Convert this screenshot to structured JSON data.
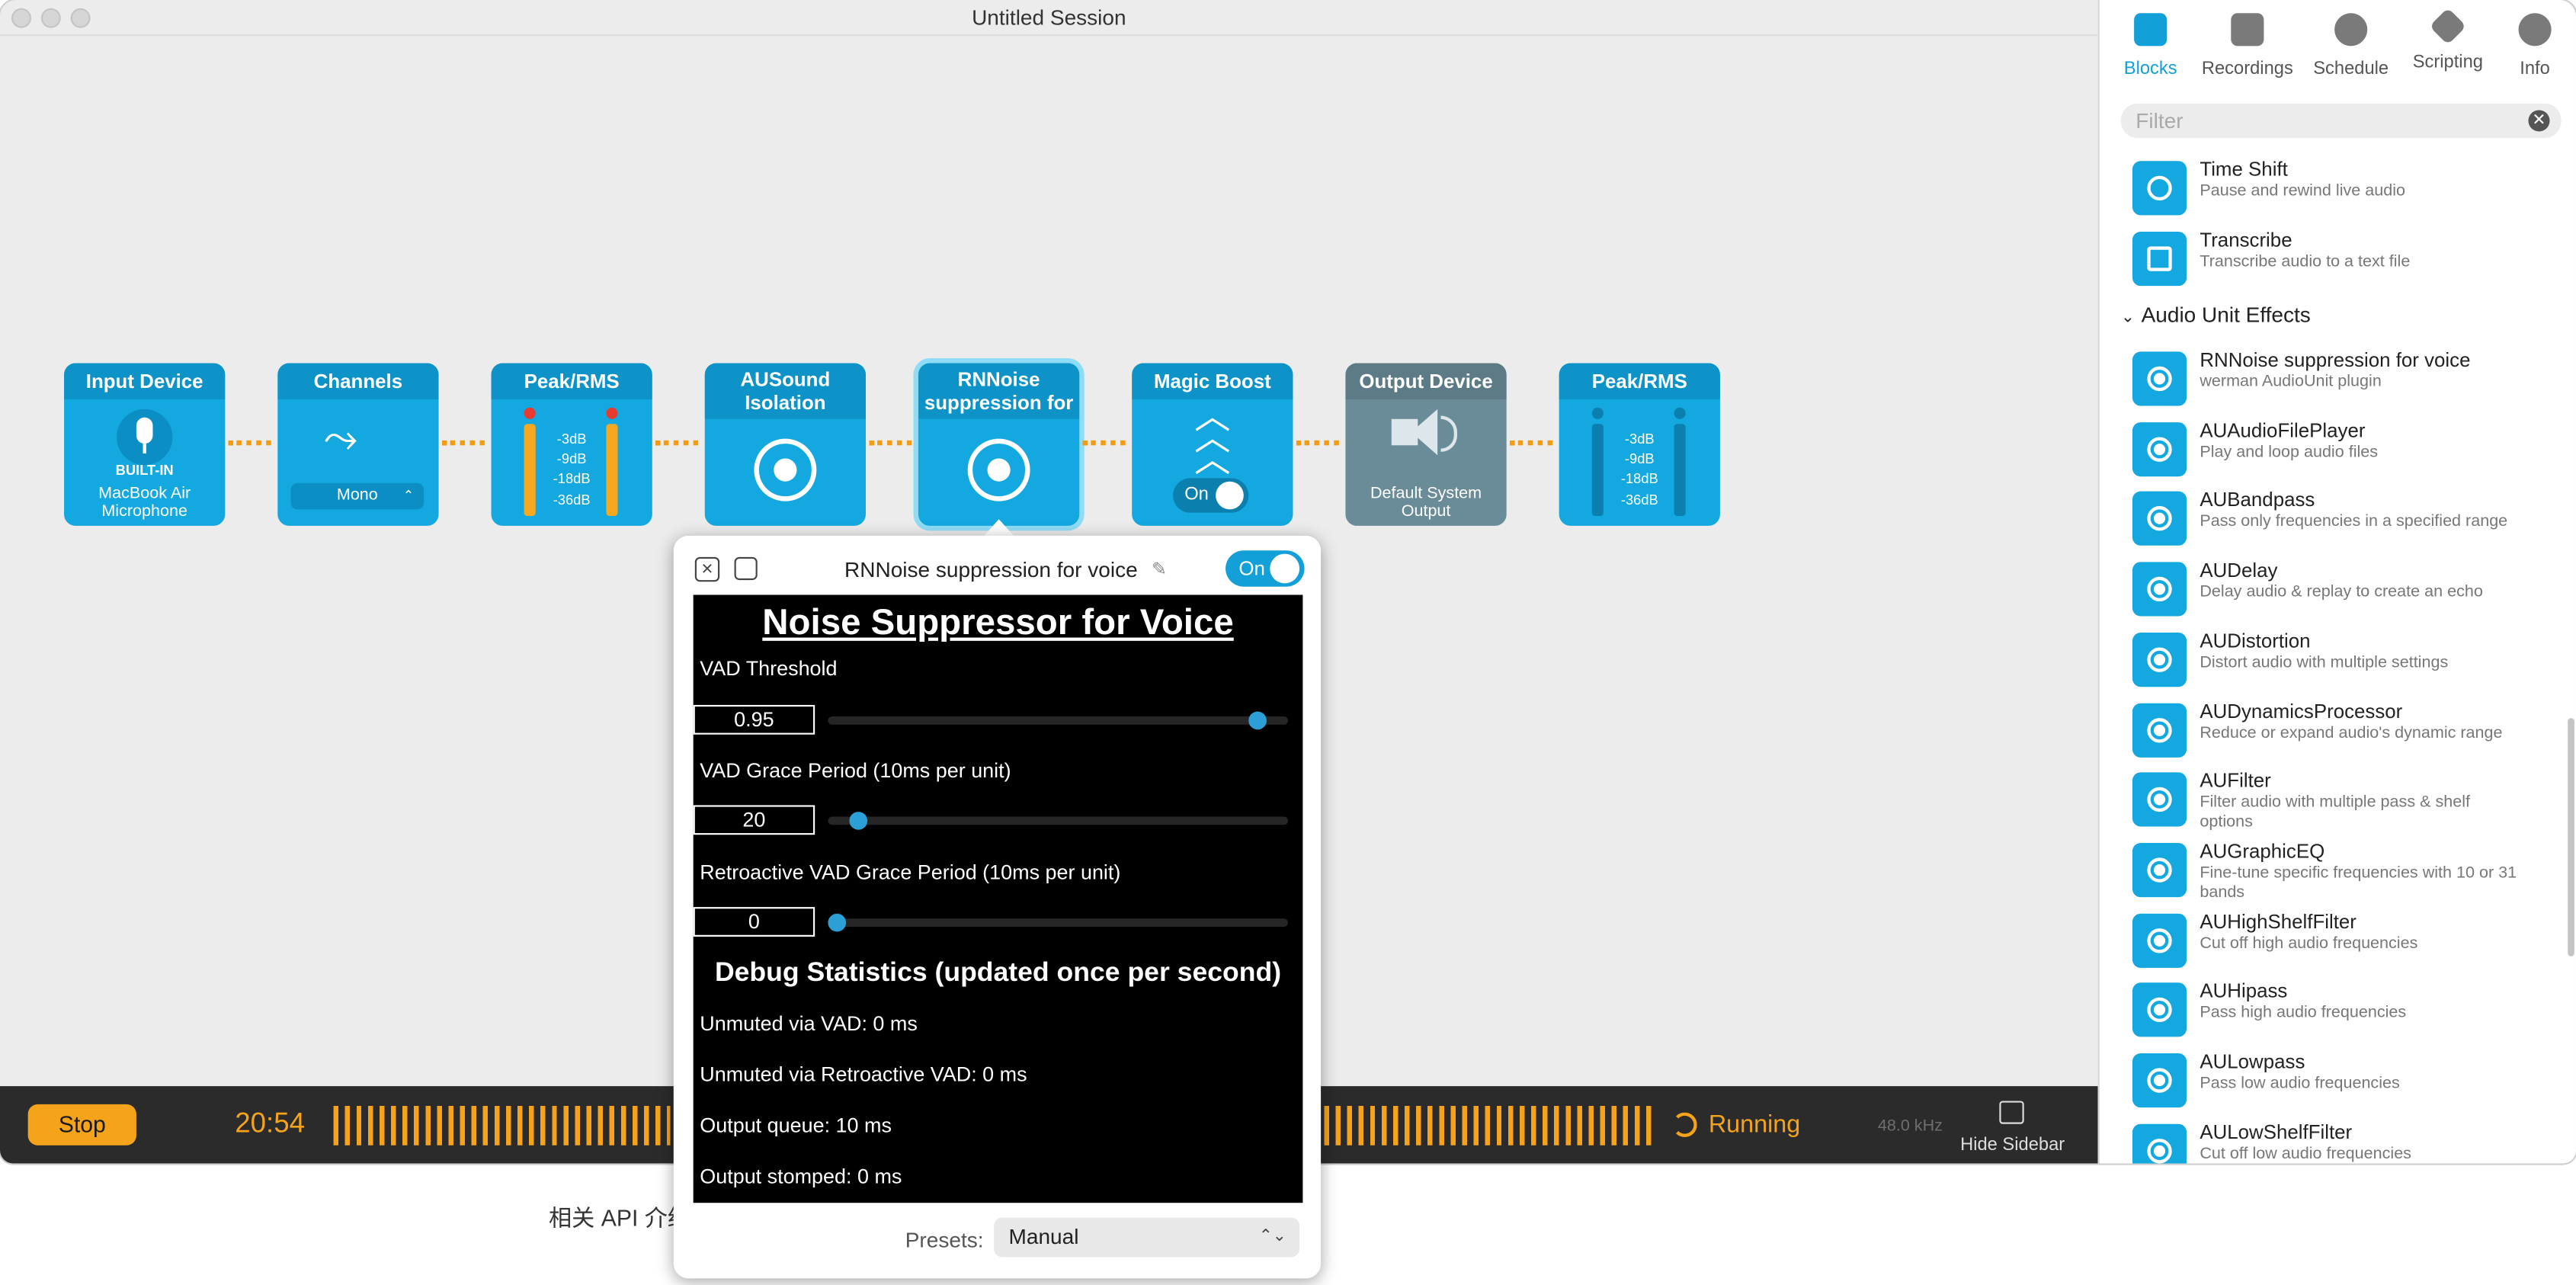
{
  "window": {
    "title": "Untitled Session"
  },
  "pipeline": {
    "blocks": [
      {
        "title": "Input Device",
        "badge": "BUILT-IN",
        "caption": "MacBook Air Microphone"
      },
      {
        "title": "Channels",
        "select_value": "Mono"
      },
      {
        "title": "Peak/RMS",
        "ticks": [
          "-3dB",
          "-9dB",
          "-18dB",
          "-36dB"
        ]
      },
      {
        "title": "AUSound Isolation"
      },
      {
        "title": "RNNoise suppression for"
      },
      {
        "title": "Magic Boost",
        "toggle": "On"
      },
      {
        "title": "Output Device",
        "caption": "Default System Output"
      },
      {
        "title": "Peak/RMS",
        "ticks": [
          "-3dB",
          "-9dB",
          "-18dB",
          "-36dB"
        ]
      }
    ]
  },
  "popover": {
    "title": "RNNoise suppression for voice",
    "toggle_label": "On",
    "heading": "Noise Suppressor for Voice",
    "params": [
      {
        "label": "VAD Threshold",
        "value": "0.95",
        "fraction": 0.95
      },
      {
        "label": "VAD Grace Period (10ms per unit)",
        "value": "20",
        "fraction": 0.05
      },
      {
        "label": "Retroactive VAD Grace Period (10ms per unit)",
        "value": "0",
        "fraction": 0.0
      }
    ],
    "debug_heading": "Debug Statistics (updated once per second)",
    "stats": [
      "Unmuted via VAD: 0 ms",
      "Unmuted via Retroactive VAD: 0 ms",
      "Output queue: 10 ms",
      "Output stomped: 0 ms"
    ],
    "presets_label": "Presets:",
    "preset_value": "Manual"
  },
  "bottombar": {
    "stop_label": "Stop",
    "timer": "20:54",
    "status": "Running",
    "sample_rate": "48.0 kHz",
    "hide_sidebar_label": "Hide Sidebar"
  },
  "sidebar": {
    "tabs": [
      "Blocks",
      "Recordings",
      "Schedule",
      "Scripting",
      "Info"
    ],
    "active_tab": "Blocks",
    "filter_placeholder": "Filter",
    "items_top": [
      {
        "name": "Time Shift",
        "desc": "Pause and rewind live audio"
      },
      {
        "name": "Transcribe",
        "desc": "Transcribe audio to a text file"
      }
    ],
    "section_title": "Audio Unit Effects",
    "items": [
      {
        "name": "RNNoise suppression for voice",
        "desc": "werman AudioUnit plugin"
      },
      {
        "name": "AUAudioFilePlayer",
        "desc": "Play and loop audio files"
      },
      {
        "name": "AUBandpass",
        "desc": "Pass only frequencies in a specified range"
      },
      {
        "name": "AUDelay",
        "desc": "Delay audio & replay to create an echo"
      },
      {
        "name": "AUDistortion",
        "desc": "Distort audio with multiple settings"
      },
      {
        "name": "AUDynamicsProcessor",
        "desc": "Reduce or expand audio's dynamic range"
      },
      {
        "name": "AUFilter",
        "desc": "Filter audio with multiple pass & shelf options"
      },
      {
        "name": "AUGraphicEQ",
        "desc": "Fine-tune specific frequencies with 10 or 31 bands"
      },
      {
        "name": "AUHighShelfFilter",
        "desc": "Cut off high audio frequencies"
      },
      {
        "name": "AUHipass",
        "desc": "Pass high audio frequencies"
      },
      {
        "name": "AULowpass",
        "desc": "Pass low audio frequencies"
      },
      {
        "name": "AULowShelfFilter",
        "desc": "Cut off low audio frequencies"
      }
    ]
  },
  "background_text": "相关 API 介绍",
  "colors": {
    "accent": "#13a8e0",
    "orange": "#f5a31a",
    "dark_bar": "#2b2b2b"
  }
}
